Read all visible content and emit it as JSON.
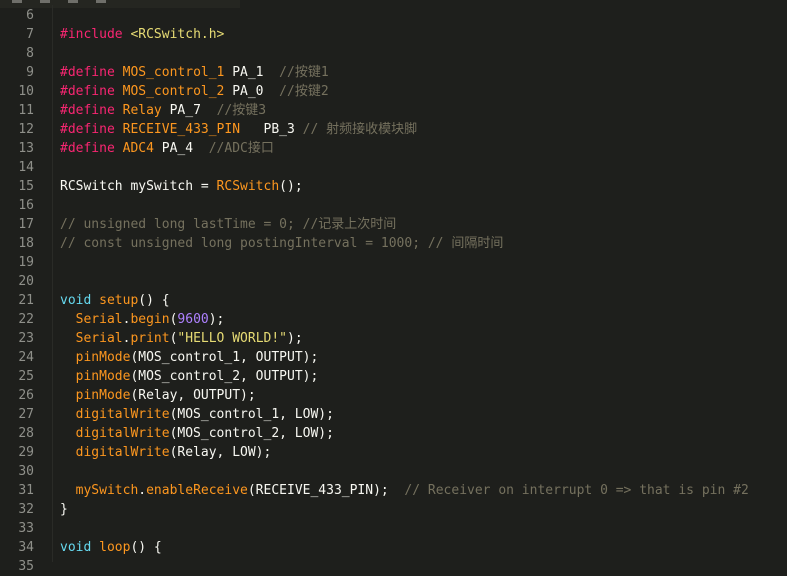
{
  "editor": {
    "lines": [
      {
        "num": "6",
        "tokens": []
      },
      {
        "num": "7",
        "tokens": [
          {
            "t": "#include",
            "c": "pp"
          },
          {
            "t": " ",
            "c": "id"
          },
          {
            "t": "<RCSwitch.h>",
            "c": "str"
          }
        ]
      },
      {
        "num": "8",
        "tokens": []
      },
      {
        "num": "9",
        "tokens": [
          {
            "t": "#define",
            "c": "pp"
          },
          {
            "t": " ",
            "c": "id"
          },
          {
            "t": "MOS_control_1",
            "c": "fn"
          },
          {
            "t": " PA_1  ",
            "c": "id"
          },
          {
            "t": "//按键1",
            "c": "cm"
          }
        ]
      },
      {
        "num": "10",
        "tokens": [
          {
            "t": "#define",
            "c": "pp"
          },
          {
            "t": " ",
            "c": "id"
          },
          {
            "t": "MOS_control_2",
            "c": "fn"
          },
          {
            "t": " PA_0  ",
            "c": "id"
          },
          {
            "t": "//按键2",
            "c": "cm"
          }
        ]
      },
      {
        "num": "11",
        "tokens": [
          {
            "t": "#define",
            "c": "pp"
          },
          {
            "t": " ",
            "c": "id"
          },
          {
            "t": "Relay",
            "c": "fn"
          },
          {
            "t": " PA_7  ",
            "c": "id"
          },
          {
            "t": "//按键3",
            "c": "cm"
          }
        ]
      },
      {
        "num": "12",
        "tokens": [
          {
            "t": "#define",
            "c": "pp"
          },
          {
            "t": " ",
            "c": "id"
          },
          {
            "t": "RECEIVE_433_PIN",
            "c": "fn"
          },
          {
            "t": "   PB_3 ",
            "c": "id"
          },
          {
            "t": "// 射频接收模块脚",
            "c": "cm"
          }
        ]
      },
      {
        "num": "13",
        "tokens": [
          {
            "t": "#define",
            "c": "pp"
          },
          {
            "t": " ",
            "c": "id"
          },
          {
            "t": "ADC4",
            "c": "fn"
          },
          {
            "t": " PA_4  ",
            "c": "id"
          },
          {
            "t": "//ADC接口",
            "c": "cm"
          }
        ]
      },
      {
        "num": "14",
        "tokens": []
      },
      {
        "num": "15",
        "tokens": [
          {
            "t": "RCSwitch mySwitch = ",
            "c": "id"
          },
          {
            "t": "RCSwitch",
            "c": "fn"
          },
          {
            "t": "();",
            "c": "id"
          }
        ]
      },
      {
        "num": "16",
        "tokens": []
      },
      {
        "num": "17",
        "tokens": [
          {
            "t": "// unsigned long lastTime = 0; //记录上次时间",
            "c": "cm"
          }
        ]
      },
      {
        "num": "18",
        "tokens": [
          {
            "t": "// const unsigned long postingInterval = 1000; // 间隔时间",
            "c": "cm"
          }
        ]
      },
      {
        "num": "19",
        "tokens": []
      },
      {
        "num": "20",
        "tokens": []
      },
      {
        "num": "21",
        "tokens": [
          {
            "t": "void",
            "c": "kw"
          },
          {
            "t": " ",
            "c": "id"
          },
          {
            "t": "setup",
            "c": "fn"
          },
          {
            "t": "() {",
            "c": "id"
          }
        ]
      },
      {
        "num": "22",
        "tokens": [
          {
            "t": "  ",
            "c": "id"
          },
          {
            "t": "Serial",
            "c": "fn"
          },
          {
            "t": ".",
            "c": "id"
          },
          {
            "t": "begin",
            "c": "fn"
          },
          {
            "t": "(",
            "c": "id"
          },
          {
            "t": "9600",
            "c": "num"
          },
          {
            "t": ");",
            "c": "id"
          }
        ]
      },
      {
        "num": "23",
        "tokens": [
          {
            "t": "  ",
            "c": "id"
          },
          {
            "t": "Serial",
            "c": "fn"
          },
          {
            "t": ".",
            "c": "id"
          },
          {
            "t": "print",
            "c": "fn"
          },
          {
            "t": "(",
            "c": "id"
          },
          {
            "t": "\"HELLO WORLD!\"",
            "c": "str"
          },
          {
            "t": ");",
            "c": "id"
          }
        ]
      },
      {
        "num": "24",
        "tokens": [
          {
            "t": "  ",
            "c": "id"
          },
          {
            "t": "pinMode",
            "c": "fn"
          },
          {
            "t": "(MOS_control_1, OUTPUT);",
            "c": "id"
          }
        ]
      },
      {
        "num": "25",
        "tokens": [
          {
            "t": "  ",
            "c": "id"
          },
          {
            "t": "pinMode",
            "c": "fn"
          },
          {
            "t": "(MOS_control_2, OUTPUT);",
            "c": "id"
          }
        ]
      },
      {
        "num": "26",
        "tokens": [
          {
            "t": "  ",
            "c": "id"
          },
          {
            "t": "pinMode",
            "c": "fn"
          },
          {
            "t": "(Relay, OUTPUT);",
            "c": "id"
          }
        ]
      },
      {
        "num": "27",
        "tokens": [
          {
            "t": "  ",
            "c": "id"
          },
          {
            "t": "digitalWrite",
            "c": "fn"
          },
          {
            "t": "(MOS_control_1, LOW);",
            "c": "id"
          }
        ]
      },
      {
        "num": "28",
        "tokens": [
          {
            "t": "  ",
            "c": "id"
          },
          {
            "t": "digitalWrite",
            "c": "fn"
          },
          {
            "t": "(MOS_control_2, LOW);",
            "c": "id"
          }
        ]
      },
      {
        "num": "29",
        "tokens": [
          {
            "t": "  ",
            "c": "id"
          },
          {
            "t": "digitalWrite",
            "c": "fn"
          },
          {
            "t": "(Relay, LOW);",
            "c": "id"
          }
        ]
      },
      {
        "num": "30",
        "tokens": []
      },
      {
        "num": "31",
        "tokens": [
          {
            "t": "  ",
            "c": "id"
          },
          {
            "t": "mySwitch",
            "c": "fn"
          },
          {
            "t": ".",
            "c": "id"
          },
          {
            "t": "enableReceive",
            "c": "fn"
          },
          {
            "t": "(RECEIVE_433_PIN);  ",
            "c": "id"
          },
          {
            "t": "// Receiver on interrupt 0 => that is pin #2",
            "c": "cm"
          }
        ]
      },
      {
        "num": "32",
        "tokens": [
          {
            "t": "}",
            "c": "id"
          }
        ]
      },
      {
        "num": "33",
        "tokens": []
      },
      {
        "num": "34",
        "tokens": [
          {
            "t": "void",
            "c": "kw"
          },
          {
            "t": " ",
            "c": "id"
          },
          {
            "t": "loop",
            "c": "fn"
          },
          {
            "t": "() {",
            "c": "id"
          }
        ]
      },
      {
        "num": "35",
        "tokens": []
      }
    ]
  },
  "colors": {
    "background": "#1e1f1c",
    "line_number": "#8f908a",
    "keyword": "#66d9ef",
    "preprocessor": "#f92672",
    "string": "#e6db74",
    "function": "#fd971f",
    "number": "#ae81ff",
    "comment": "#75715e"
  }
}
